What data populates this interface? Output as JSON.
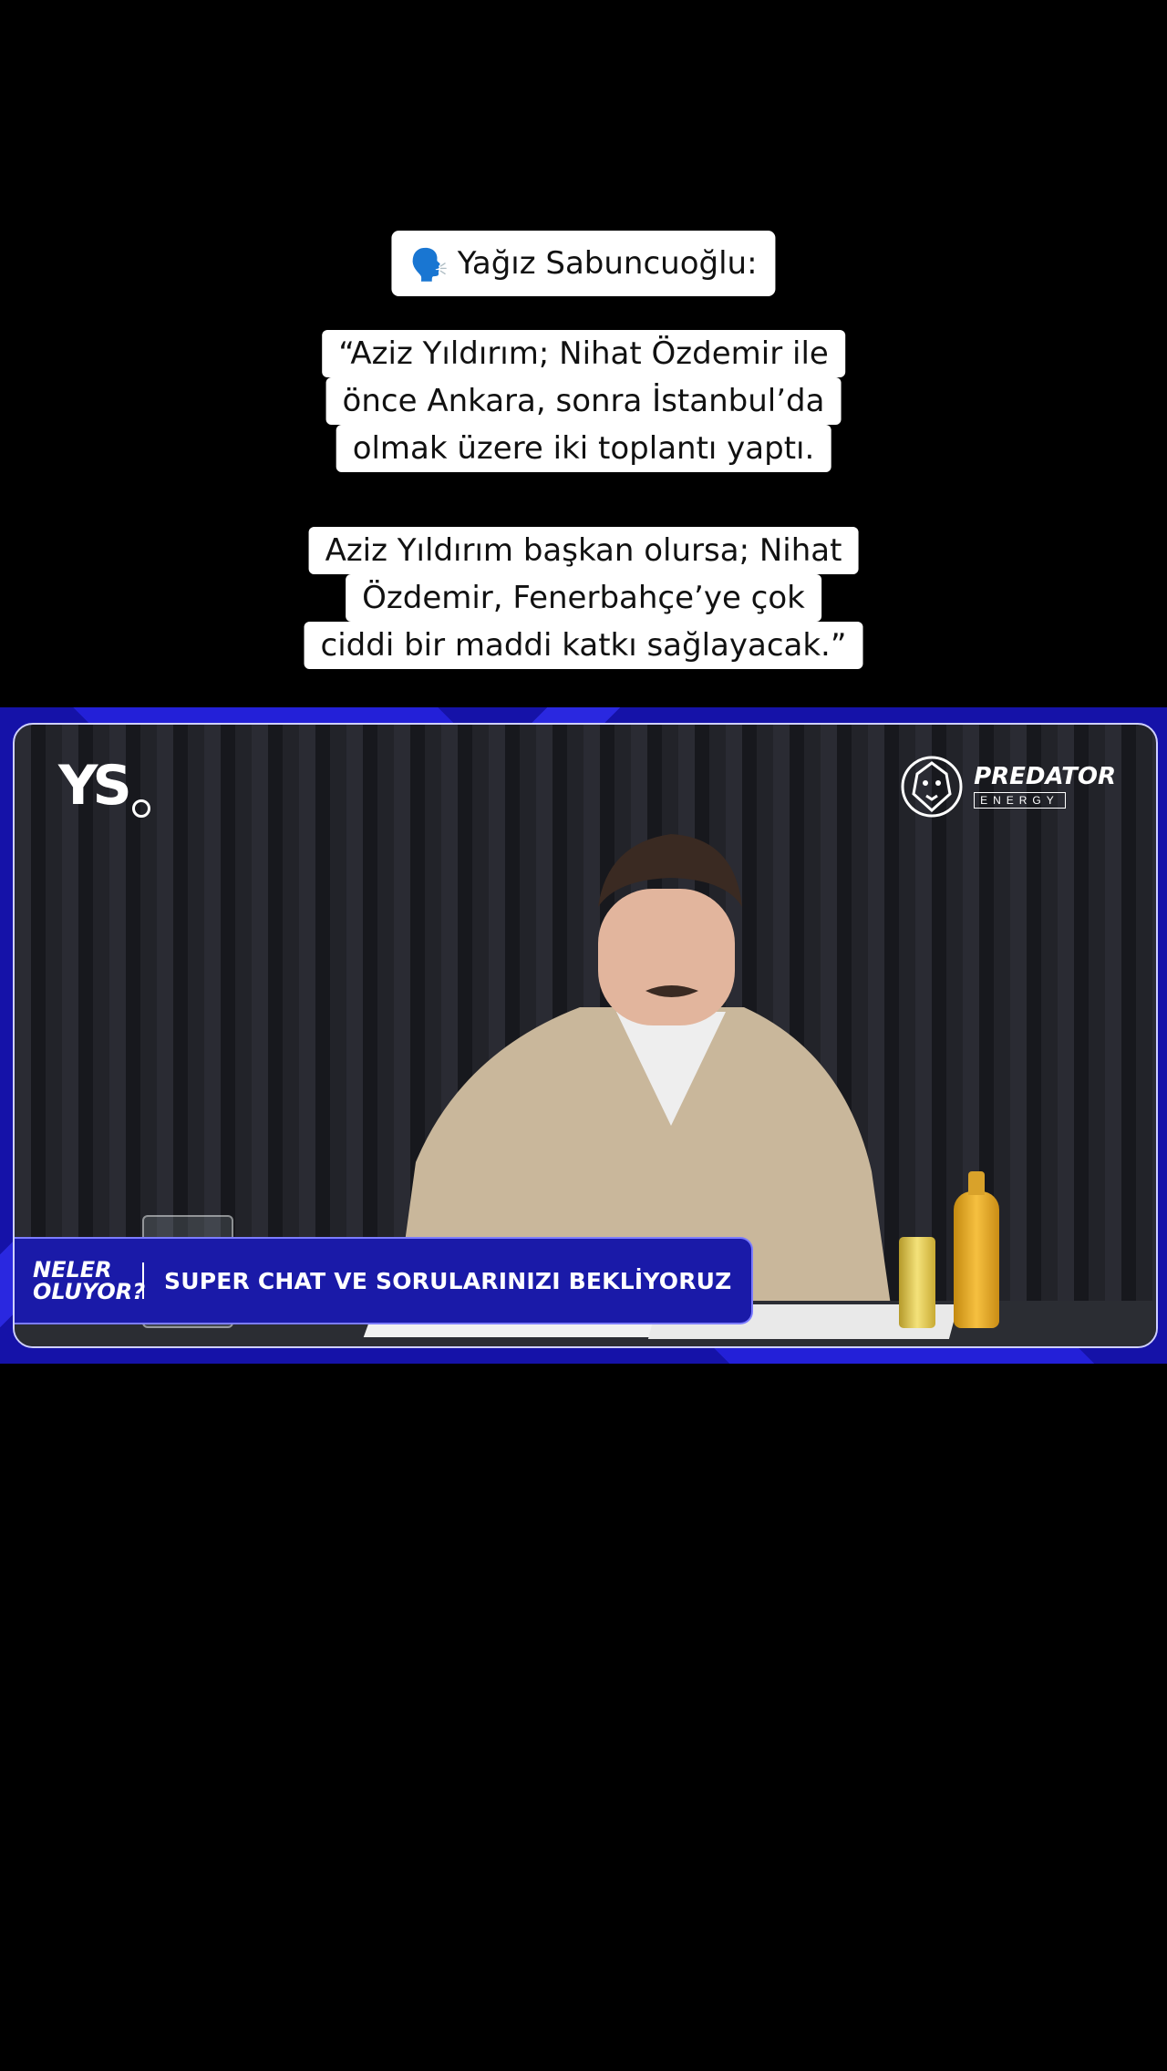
{
  "speaker": {
    "emoji": "🗣️",
    "name": "Yağız Sabuncuoğlu:"
  },
  "quote1": [
    "“Aziz Yıldırım; Nihat Özdemir ile",
    "önce Ankara, sonra İstanbul’da",
    "olmak üzere iki toplantı yaptı."
  ],
  "quote2": [
    "Aziz Yıldırım başkan olursa; Nihat",
    "Özdemir, Fenerbahçe’ye çok",
    "ciddi bir maddi katkı sağlayacak.”"
  ],
  "video": {
    "channel_logo": "YS",
    "sponsor": {
      "brand": "PREDATOR",
      "sub": "ENERGY",
      "icon": "lion-icon"
    },
    "lower_third": {
      "show": "NELER OLUYOR?",
      "text": "SUPER CHAT VE SORULARINIZI BEKLİYORUZ"
    }
  }
}
